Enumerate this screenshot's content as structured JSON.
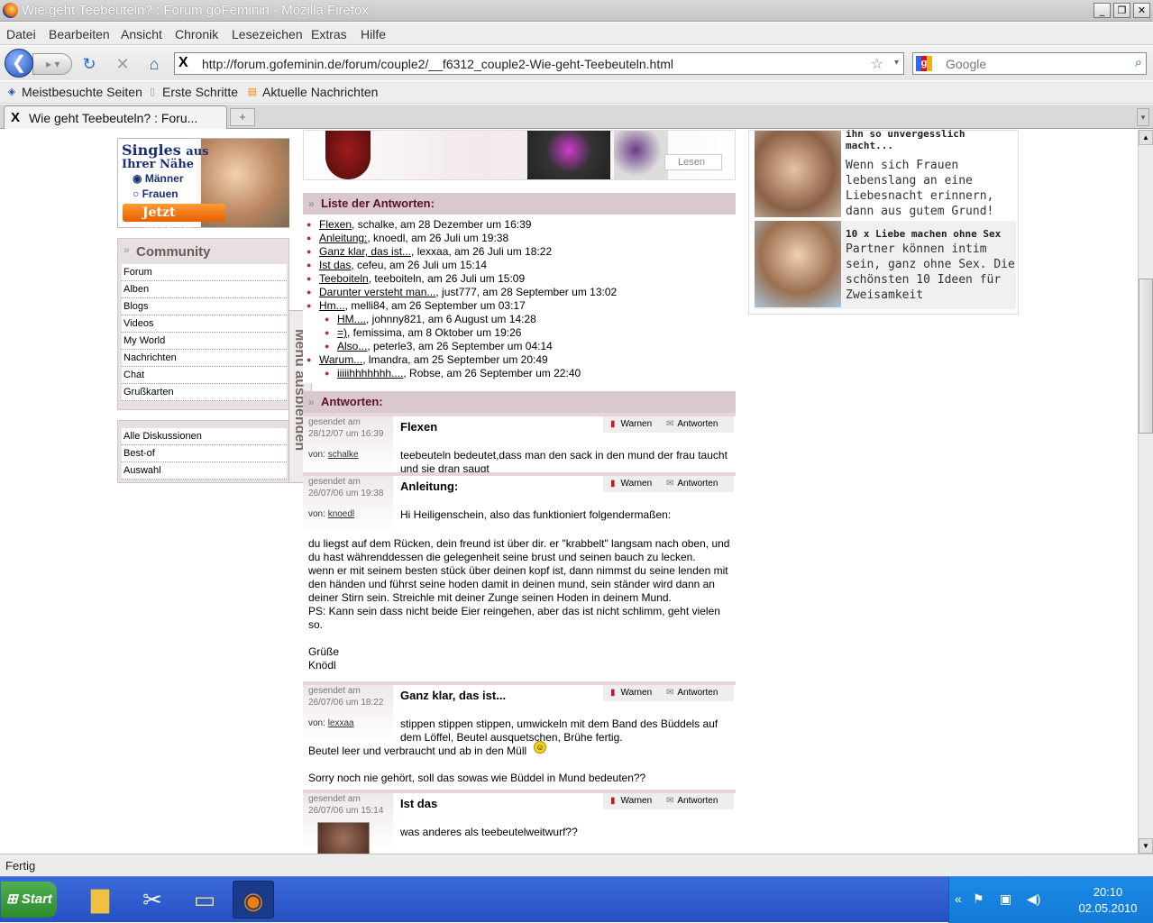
{
  "window": {
    "title": "Wie geht Teebeuteln? : Forum goFeminin - Mozilla Firefox"
  },
  "menu": [
    "Datei",
    "Bearbeiten",
    "Ansicht",
    "Chronik",
    "Lesezeichen",
    "Extras",
    "Hilfe"
  ],
  "nav": {
    "url": "http://forum.gofeminin.de/forum/couple2/__f6312_couple2-Wie-geht-Teebeuteln.html",
    "search_placeholder": "Google"
  },
  "bookmarks": [
    "Meistbesuchte Seiten",
    "Erste Schritte",
    "Aktuelle Nachrichten"
  ],
  "tab": {
    "title": "Wie geht Teebeuteln? : Foru..."
  },
  "status": "Fertig",
  "taskbar": {
    "start": "Start",
    "time": "20:10",
    "date": "02.05.2010"
  },
  "singles": {
    "title": "Singles",
    "aus": "aus",
    "subtitle": "Ihrer Nähe",
    "opt1": "Männer",
    "opt2": "Frauen",
    "button": "Jetzt suchen"
  },
  "community": {
    "title": "Community",
    "items": [
      "Forum",
      "Alben",
      "Blogs",
      "Videos",
      "My World",
      "Nachrichten",
      "Chat",
      "Grußkarten"
    ]
  },
  "discussions": [
    "Alle Diskussionen",
    "Best-of",
    "Auswahl"
  ],
  "menutoggle": "Menü ausblenden",
  "banner": {
    "lesen": "Lesen"
  },
  "answerlist": {
    "title": "Liste der Antworten:",
    "items": [
      {
        "link": "Flexen",
        "rest": ", schalke, am 28 Dezember um 16:39",
        "sub": false
      },
      {
        "link": "Anleitung:",
        "rest": ", knoedl, am 26 Juli um 19:38",
        "sub": false
      },
      {
        "link": "Ganz klar, das ist...",
        "rest": ", lexxaa, am 26 Juli um 18:22",
        "sub": false
      },
      {
        "link": "Ist das",
        "rest": ", cefeu, am 26 Juli um 15:14",
        "sub": false
      },
      {
        "link": "Teeboiteln",
        "rest": ", teeboiteln, am 26 Juli um 15:09",
        "sub": false
      },
      {
        "link": "Darunter versteht man...",
        "rest": ", just777, am 28 September um 13:02",
        "sub": false
      },
      {
        "link": "Hm...",
        "rest": ", melli84, am 26 September um 03:17",
        "sub": false
      },
      {
        "link": "HM....",
        "rest": ", johnny821, am 6 August um 14:28",
        "sub": true
      },
      {
        "link": "=)",
        "rest": ", femissima, am 8 Oktober um 19:26",
        "sub": true
      },
      {
        "link": "Also...",
        "rest": ", peterle3, am 26 September um 04:14",
        "sub": true
      },
      {
        "link": "Warum...",
        "rest": ", lmandra, am 25 September um 20:49",
        "sub": false
      },
      {
        "link": "iiiiihhhhhhh....",
        "rest": ", Robse, am 26 September um 22:40",
        "sub": true
      }
    ]
  },
  "posts": {
    "title": "Antworten:",
    "warn": "Warnen",
    "reply": "Antworten",
    "items": [
      {
        "sent": "gesendet am",
        "date": "28/12/07 um 16:39",
        "von": "von:",
        "user": "schalke",
        "title": "Flexen",
        "body": "teebeuteln bedeutet,dass man den sack in den mund der frau taucht und sie dran saugt",
        "full": ""
      },
      {
        "sent": "gesendet am",
        "date": "26/07/06 um 19:38",
        "von": "von:",
        "user": "knoedl",
        "title": "Anleitung:",
        "body": "Hi Heiligenschein, also das funktioniert folgendermaßen:",
        "full": "du liegst auf dem Rücken, dein freund ist über dir. er \"krabbelt\" langsam nach oben, und du hast währenddessen die gelegenheit seine brust und seinen bauch zu lecken.\nwenn er mit seinem besten stück über deinen kopf ist, dann nimmst du seine lenden mit den händen und führst seine hoden damit in deinen mund, sein ständer wird dann an deiner Stirn sein. Streichle mit deiner Zunge seinen Hoden in deinem Mund.\nPS: Kann sein dass nicht beide Eier reingehen, aber das ist nicht schlimm, geht vielen so.\n\nGrüße\nKnödl"
      },
      {
        "sent": "gesendet am",
        "date": "26/07/06 um 18:22",
        "von": "von:",
        "user": "lexxaa",
        "title": "Ganz klar, das ist...",
        "body": "stippen stippen stippen, umwickeln mit dem Band des Büddels auf dem Löffel, Beutel ausquetschen, Brühe fertig.",
        "full": "Beutel leer und verbraucht und ab in den Müll \n\nSorry noch nie gehört, soll das sowas wie Büddel in Mund bedeuten??"
      },
      {
        "sent": "gesendet am",
        "date": "26/07/06 um 15:14",
        "von": "",
        "user": "",
        "title": "Ist das",
        "body": "was anderes als teebeutelweitwurf??",
        "full": ""
      }
    ]
  },
  "promos": [
    {
      "title": "Der perfekte Liebesakt: Was ihn so unvergesslich macht...",
      "desc": "Wenn sich Frauen lebenslang an eine Liebesnacht erinnern, dann aus gutem Grund!"
    },
    {
      "title": "10 x Liebe machen ohne Sex",
      "desc": "Partner können intim sein, ganz ohne Sex. Die schönsten 10 Ideen für Zweisamkeit"
    }
  ]
}
